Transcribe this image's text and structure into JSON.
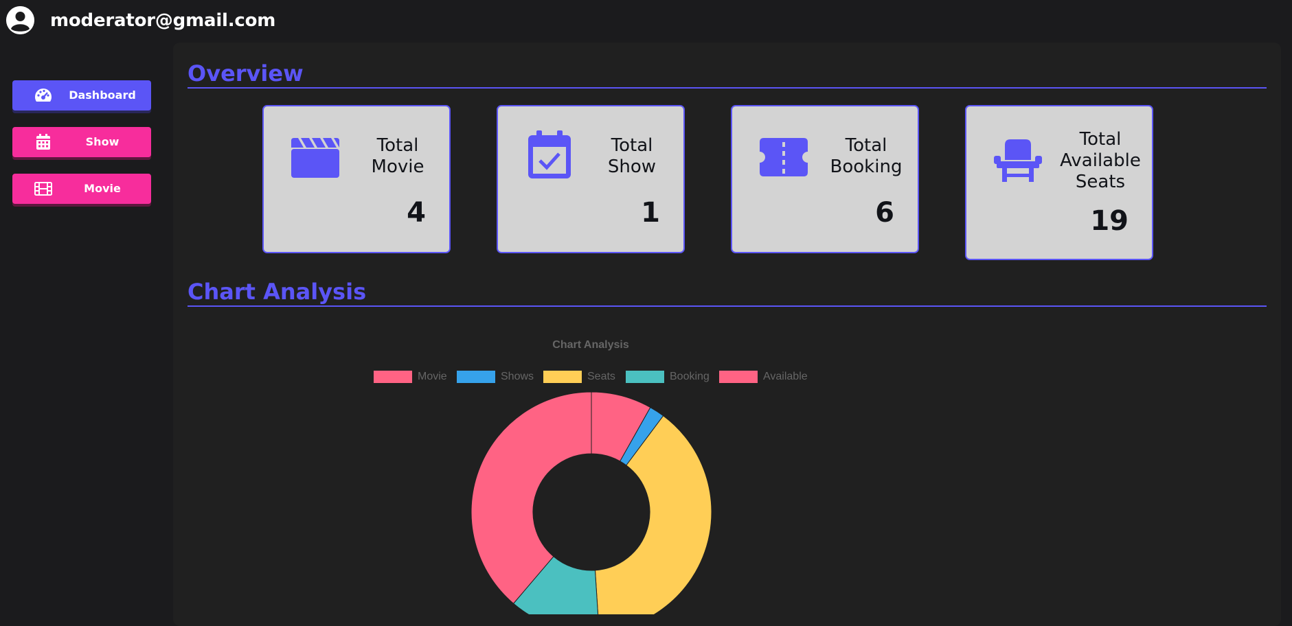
{
  "header": {
    "user_email": "moderator@gmail.com"
  },
  "sidebar": {
    "items": [
      {
        "label": "Dashboard",
        "icon": "gauge-icon",
        "color": "#5b55f6"
      },
      {
        "label": "Show",
        "icon": "calendar-icon",
        "color": "#f72d9c"
      },
      {
        "label": "Movie",
        "icon": "film-icon",
        "color": "#f72d9c"
      }
    ]
  },
  "overview": {
    "title": "Overview",
    "cards": [
      {
        "title_lines": [
          "Total",
          "Movie"
        ],
        "value": "4",
        "icon": "clapperboard-icon"
      },
      {
        "title_lines": [
          "Total",
          "Show"
        ],
        "value": "1",
        "icon": "calendar-check-icon"
      },
      {
        "title_lines": [
          "Total",
          "Booking"
        ],
        "value": "6",
        "icon": "ticket-icon"
      },
      {
        "title_lines": [
          "Total",
          "Available",
          "Seats"
        ],
        "value": "19",
        "icon": "chair-icon"
      }
    ]
  },
  "analysis": {
    "title": "Chart Analysis"
  },
  "chart_data": {
    "type": "pie",
    "variant": "doughnut",
    "title": "Chart Analysis",
    "categories": [
      "Movie",
      "Shows",
      "Seats",
      "Booking",
      "Available"
    ],
    "values": [
      4,
      1,
      19,
      6,
      19
    ],
    "colors": [
      "#ff6384",
      "#36a2eb",
      "#ffce56",
      "#4bc0c0",
      "#ff6384"
    ],
    "legend": "top"
  },
  "colors": {
    "accent": "#5b55f6",
    "pink": "#f72d9c",
    "background": "#1b1b1d",
    "panel": "#202020",
    "card": "#d3d3d3"
  }
}
